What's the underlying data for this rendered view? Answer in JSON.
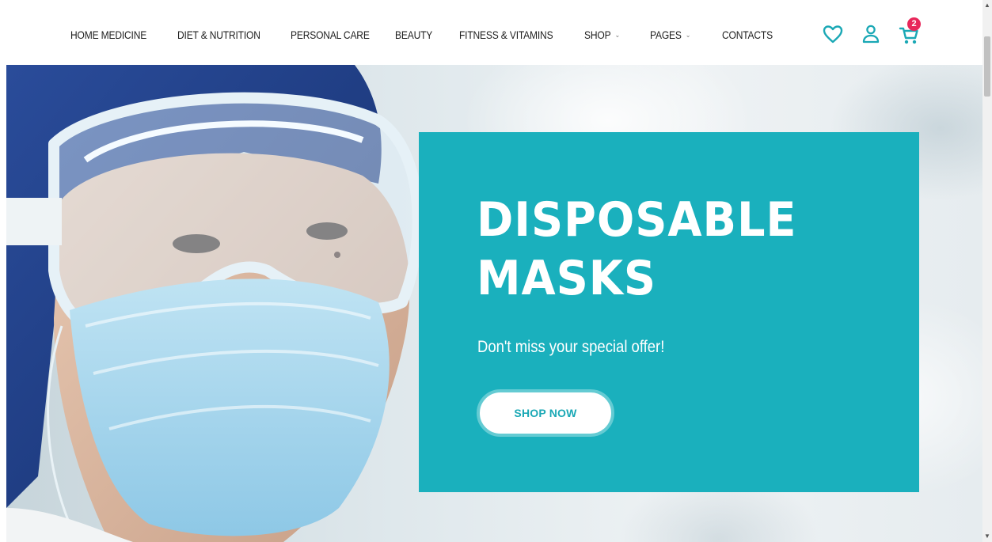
{
  "nav": {
    "items": [
      {
        "label": "HOME MEDICINE",
        "has_dropdown": false
      },
      {
        "label": "DIET & NUTRITION",
        "has_dropdown": false
      },
      {
        "label": "PERSONAL CARE",
        "has_dropdown": false
      },
      {
        "label": "BEAUTY",
        "has_dropdown": false
      },
      {
        "label": "FITNESS & VITAMINS",
        "has_dropdown": false
      },
      {
        "label": "SHOP",
        "has_dropdown": true
      },
      {
        "label": "PAGES",
        "has_dropdown": true
      },
      {
        "label": "CONTACTS",
        "has_dropdown": false
      }
    ]
  },
  "header_icons": {
    "wishlist_icon": "heart-icon",
    "account_icon": "user-icon",
    "cart_icon": "cart-icon",
    "cart_count": "2"
  },
  "hero": {
    "title": "DISPOSABLE MASKS",
    "subtitle": "Don't miss your special offer!",
    "cta_label": "SHOP NOW"
  },
  "colors": {
    "accent_teal": "#1ab0bd",
    "icon_teal": "#1aa8b5",
    "badge_pink": "#e8275a",
    "nav_text": "#1f1f1f"
  }
}
